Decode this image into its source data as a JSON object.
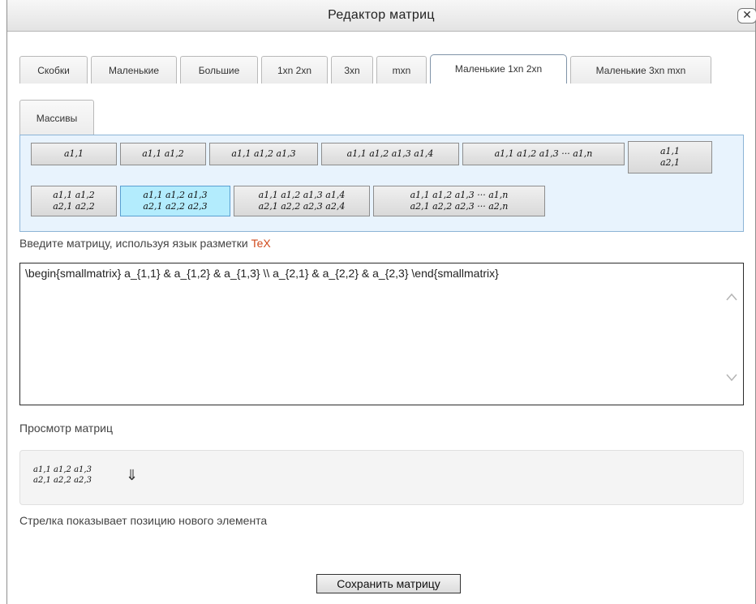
{
  "dialog": {
    "title": "Редактор матриц",
    "close_label": "✕"
  },
  "tabs": [
    "Скобки",
    "Маленькие",
    "Большие",
    "1xn 2xn",
    "3xn",
    "mxn",
    "Маленькие 1xn 2xn",
    "Маленькие 3xn mxn",
    "Массивы"
  ],
  "active_tab": "Маленькие 1xn 2xn",
  "matrix_buttons": [
    "a1,1",
    "a1,1 a1,2",
    "a1,1 a1,2 a1,3",
    "a1,1 a1,2 a1,3 a1,4",
    "a1,1 a1,2 a1,3 ··· a1,n",
    "a1,1\na2,1",
    "a1,1 a1,2\na2,1 a2,2",
    "a1,1 a1,2 a1,3\na2,1 a2,2 a2,3",
    "a1,1 a1,2 a1,3 a1,4\na2,1 a2,2 a2,3 a2,4",
    "a1,1 a1,2 a1,3 ··· a1,n\na2,1 a2,2 a2,3 ··· a2,n"
  ],
  "selected_button": "a1,1 a1,2 a1,3\na2,1 a2,2 a2,3",
  "input_label": "Введите матрицу, используя язык разметки",
  "input_label_link": "TeX",
  "editor_value": "\\begin{smallmatrix} a_{1,1} & a_{1,2} & a_{1,3} \\\\ a_{2,1} & a_{2,2} & a_{2,3} \\end{smallmatrix}",
  "preview_label": "Просмотр матриц",
  "preview_matrix": "a1,1 a1,2 a1,3\na2,1 a2,2 a2,3",
  "preview_arrow": "⇓",
  "hint": "Стрелка показывает позицию нового элемента",
  "save_label": "Сохранить матрицу",
  "colors": {
    "tex_link": "#d04a1c",
    "selected_button": "#b3ecfd",
    "panel_bg": "#e8f3fd"
  }
}
